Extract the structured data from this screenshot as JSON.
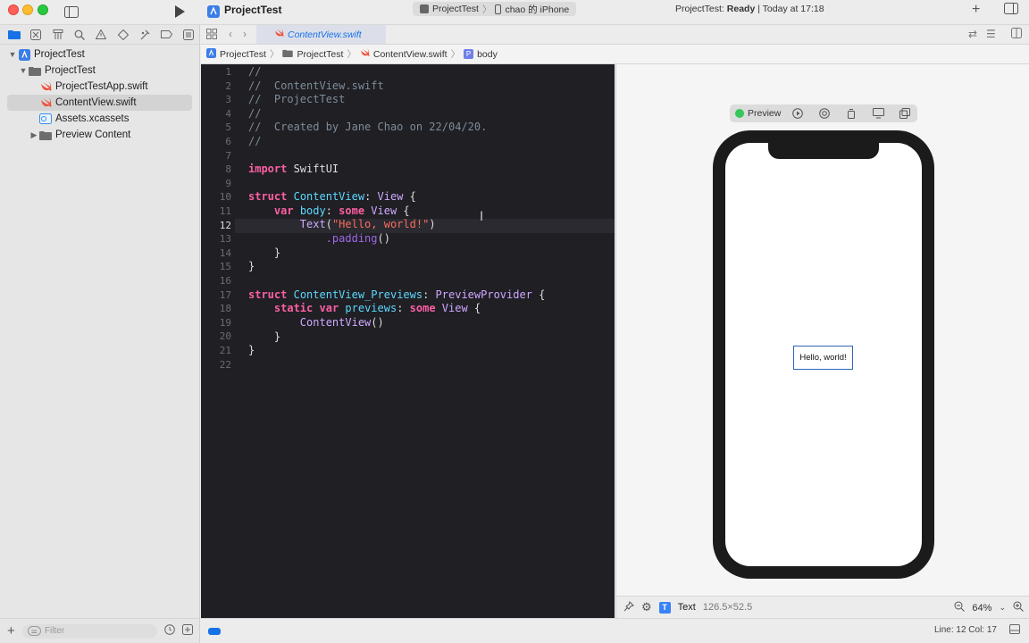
{
  "titlebar": {
    "project_title": "ProjectTest",
    "scheme": "ProjectTest",
    "destination": "chao 的 iPhone",
    "status_prefix": "ProjectTest: ",
    "status_state": "Ready",
    "status_suffix": " | Today at 17:18",
    "add_label": "+"
  },
  "navigator": {
    "tree": [
      {
        "label": "ProjectTest",
        "level": 0,
        "icon": "app-project-icon"
      },
      {
        "label": "ProjectTest",
        "level": 1,
        "icon": "folder-icon"
      },
      {
        "label": "ProjectTestApp.swift",
        "level": 2,
        "icon": "swift-file-icon"
      },
      {
        "label": "ContentView.swift",
        "level": 2,
        "icon": "swift-file-icon",
        "selected": true
      },
      {
        "label": "Assets.xcassets",
        "level": 2,
        "icon": "asset-catalog-icon"
      },
      {
        "label": "Preview Content",
        "level": 2,
        "icon": "folder-icon"
      }
    ],
    "filter_placeholder": "Filter"
  },
  "editor": {
    "tab_label": "ContentView.swift",
    "jumpbar": [
      "ProjectTest",
      "ProjectTest",
      "ContentView.swift",
      "body"
    ],
    "line_numbers": [
      "1",
      "2",
      "3",
      "4",
      "5",
      "6",
      "7",
      "8",
      "9",
      "10",
      "11",
      "12",
      "13",
      "14",
      "15",
      "16",
      "17",
      "18",
      "19",
      "20",
      "21",
      "22"
    ],
    "lines": {
      "l1": "//",
      "l2": "//  ContentView.swift",
      "l3": "//  ProjectTest",
      "l4": "//",
      "l5": "//  Created by Jane Chao on 22/04/20.",
      "l6": "//",
      "l8_kw": "import",
      "l8_rest": " SwiftUI",
      "l10_kw": "struct",
      "l10_name": "ContentView",
      "l10_colon": ": ",
      "l10_type": "View",
      "l10_brace": " {",
      "l11_indent": "    ",
      "l11_kw": "var",
      "l11_name": " body",
      "l11_colon": ": ",
      "l11_kw2": "some",
      "l11_type": " View",
      "l11_brace": " {",
      "l12_indent": "        ",
      "l12_fn": "Text",
      "l12_paren": "(",
      "l12_str": "\"Hello, world!\"",
      "l12_close": ")",
      "l13_indent": "            ",
      "l13_fn": ".padding",
      "l13_paren": "()",
      "l14": "    }",
      "l15": "}",
      "l17_kw": "struct",
      "l17_name": "ContentView_Previews",
      "l17_colon": ": ",
      "l17_type": "PreviewProvider",
      "l17_brace": " {",
      "l18_indent": "    ",
      "l18_kw": "static",
      "l18_kw2": " var",
      "l18_name": " previews",
      "l18_colon": ": ",
      "l18_kw3": "some",
      "l18_type": " View",
      "l18_brace": " {",
      "l19_indent": "        ",
      "l19_fn": "ContentView",
      "l19_paren": "()",
      "l20": "    }",
      "l21": "}"
    }
  },
  "canvas": {
    "preview_label": "Preview",
    "hello_text": "Hello, world!",
    "selection_type": "Text",
    "selection_size": "126.5×52.5",
    "zoom": "64%"
  },
  "statusbar": {
    "line_col": "Line: 12  Col: 17"
  },
  "colors": {
    "accent": "#1672e6",
    "editor_bg": "#1f1f24",
    "keyword": "#fc5fa3",
    "type": "#5dd8ff",
    "string": "#fc6a5d",
    "comment": "#7f8c98"
  }
}
